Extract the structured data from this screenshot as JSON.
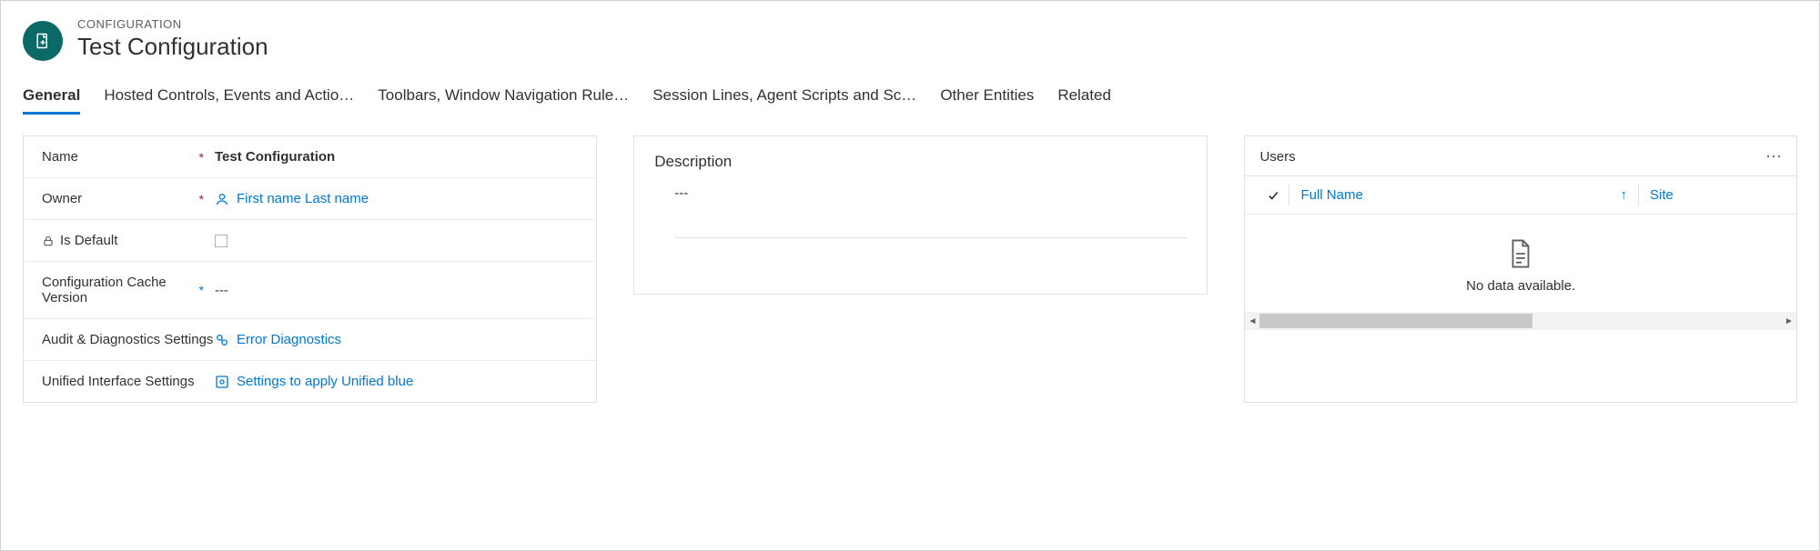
{
  "header": {
    "breadcrumb": "CONFIGURATION",
    "title": "Test Configuration"
  },
  "tabs": [
    {
      "label": "General",
      "active": true
    },
    {
      "label": "Hosted Controls, Events and Actio…"
    },
    {
      "label": "Toolbars, Window Navigation Rule…"
    },
    {
      "label": "Session Lines, Agent Scripts and Sc…"
    },
    {
      "label": "Other Entities"
    },
    {
      "label": "Related"
    }
  ],
  "form": {
    "name_label": "Name",
    "name_value": "Test Configuration",
    "owner_label": "Owner",
    "owner_value": "First name Last name",
    "isdefault_label": "Is Default",
    "cache_label": "Configuration Cache Version",
    "cache_value": "---",
    "audit_label": "Audit & Diagnostics Settings",
    "audit_value": "Error Diagnostics",
    "unified_label": "Unified Interface Settings",
    "unified_value": "Settings to apply Unified blue"
  },
  "description": {
    "label": "Description",
    "value": "---"
  },
  "users": {
    "title": "Users",
    "col_fullname": "Full Name",
    "col_site": "Site",
    "empty": "No data available."
  }
}
